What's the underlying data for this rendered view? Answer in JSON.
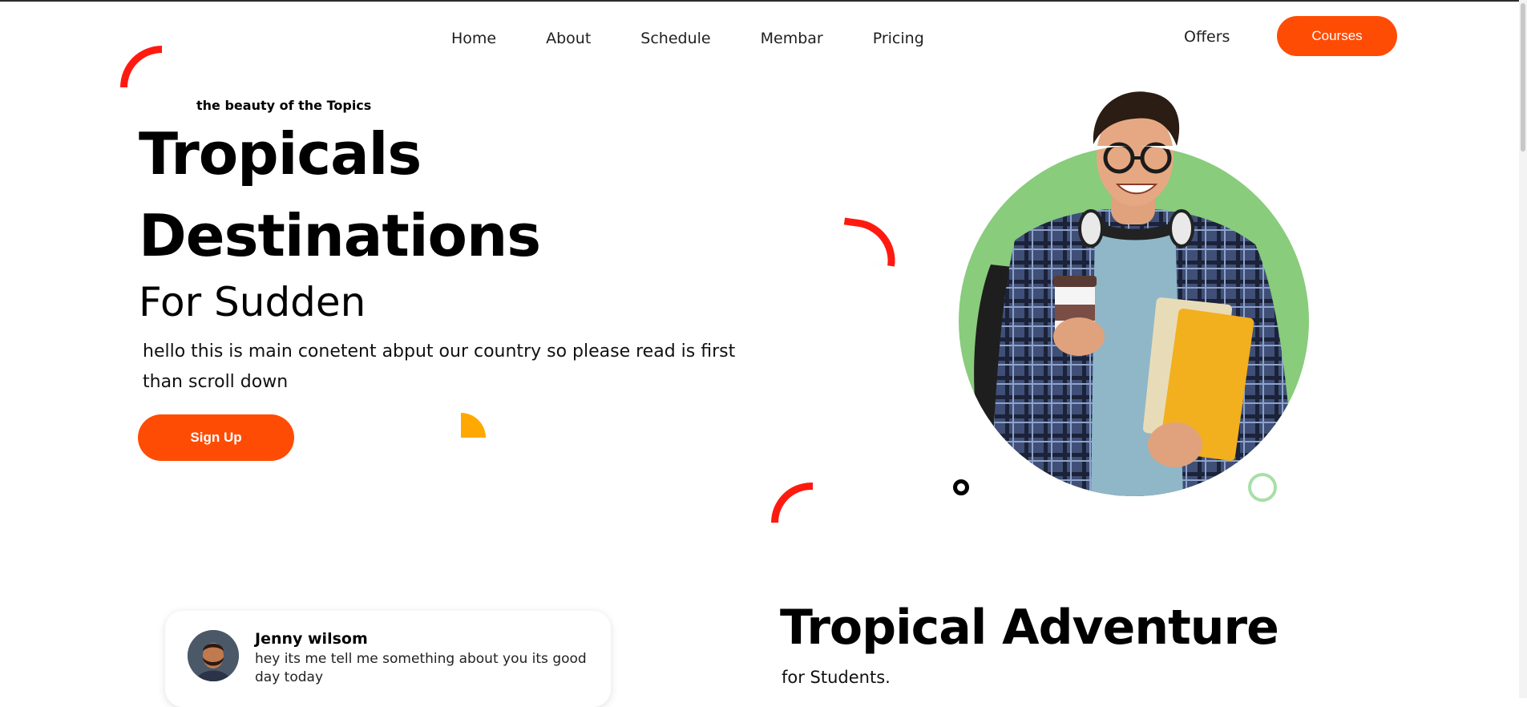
{
  "nav": {
    "items": [
      "Home",
      "About",
      "Schedule",
      "Membar",
      "Pricing"
    ],
    "offers": "Offers",
    "courses": "Courses"
  },
  "hero": {
    "eyebrow": "the beauty of the Topics",
    "title_line1": "Tropicals",
    "title_line2": "Destinations",
    "title_line3": "For Sudden",
    "lead": "hello this is main conetent abput our country so please read is first than scroll down",
    "signup": "Sign Up"
  },
  "testimonial": {
    "name": "Jenny wilsom",
    "text": "hey its me tell me something about you its good day today"
  },
  "section": {
    "title": "Tropical Adventure",
    "subtitle": "for Students."
  },
  "colors": {
    "accent": "#ff4c05",
    "arc_red": "#ff1a10",
    "arc_orange": "#ffa900",
    "hero_circle": "#88cc7c",
    "ring_green": "#a8dfa8"
  },
  "icons": [
    "student-photo",
    "avatar-photo"
  ]
}
